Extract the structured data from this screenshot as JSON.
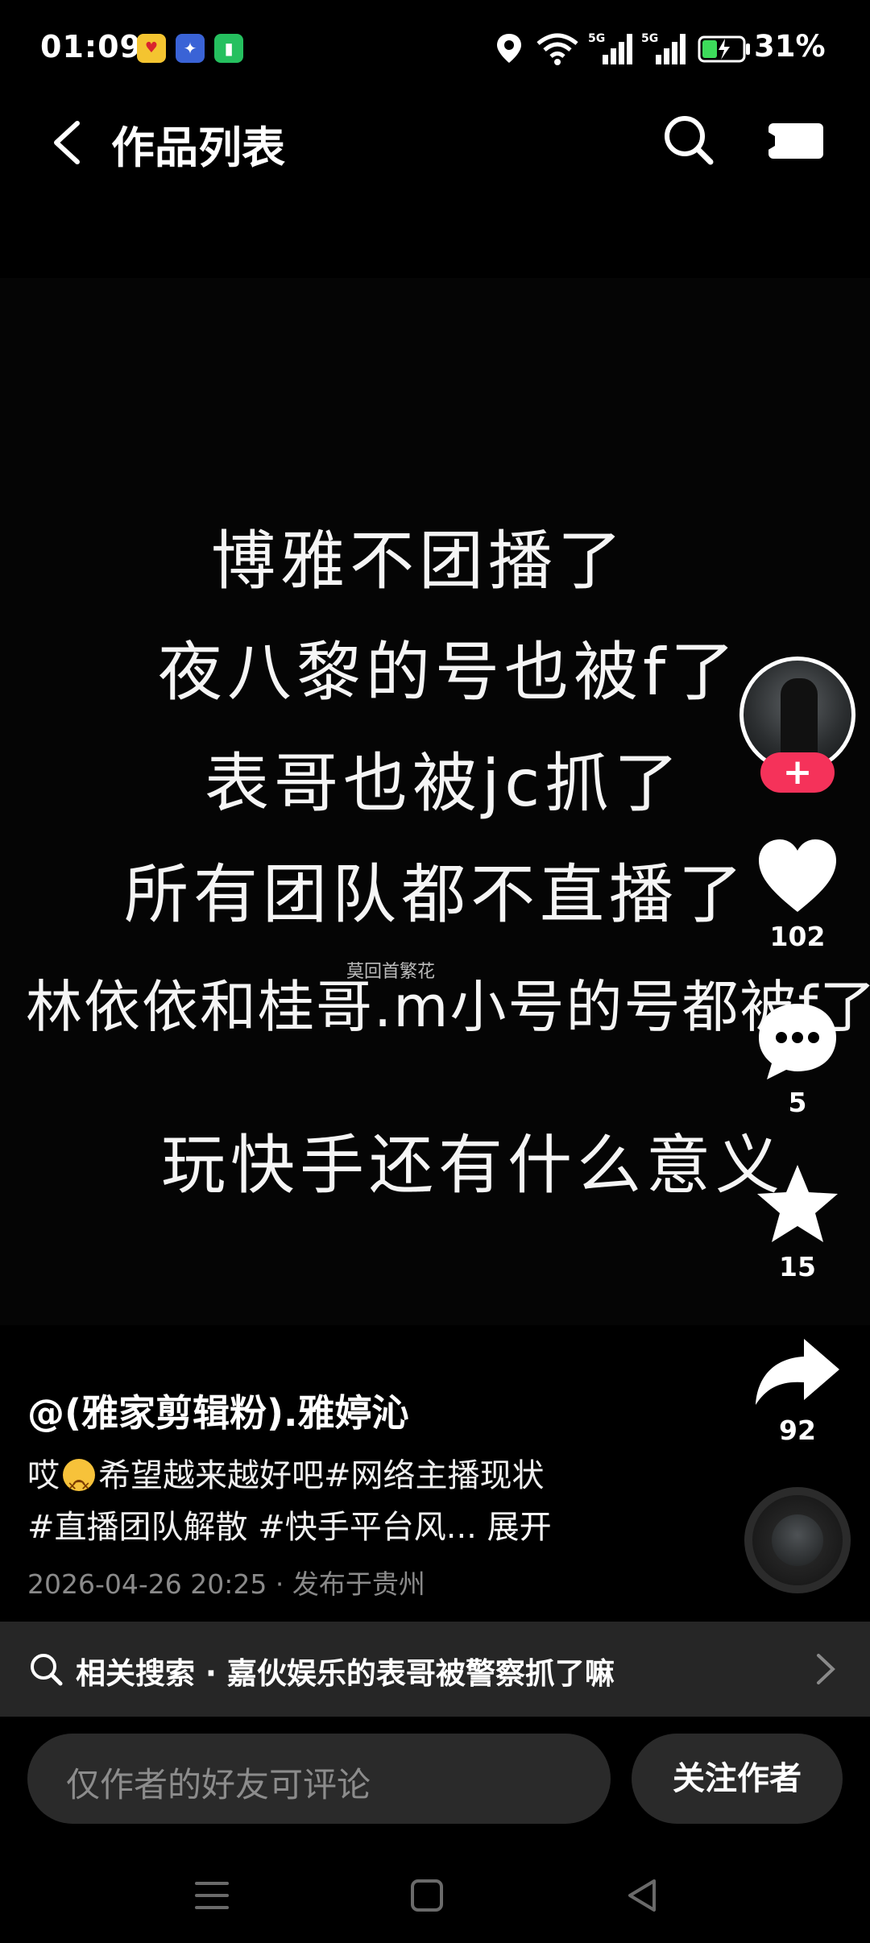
{
  "status_bar": {
    "time": "01:09",
    "battery": "31%",
    "app_icons": [
      "game-app-icon",
      "app-store-icon",
      "battery-saver-app-icon"
    ],
    "icons": [
      "location-icon",
      "wifi-icon",
      "signal-5g-icon",
      "signal-5g-icon",
      "battery-icon"
    ]
  },
  "header": {
    "title": "作品列表",
    "back_icon": "chevron-left-icon",
    "search_icon": "search-icon",
    "camera_icon": "camera-icon"
  },
  "video": {
    "lines": [
      "博雅不团播了",
      "夜八黎的号也被f了",
      "表哥也被jc抓了",
      "所有团队都不直播了",
      "林依依和桂哥.m小号的号都被f了",
      "玩快手还有什么意义"
    ],
    "watermark": "莫回首繁花"
  },
  "actions": {
    "likes": "102",
    "comments": "5",
    "favorites": "15",
    "shares": "92",
    "follow_plus": "+"
  },
  "post": {
    "author": "@(雅家剪辑粉).雅婷沁",
    "desc_part1": "哎",
    "desc_part2": "希望越来越好吧#网络主播现状",
    "desc_line2": "#直播团队解散 #快手平台风...",
    "expand": "展开",
    "meta": "2026-04-26 20:25 · 发布于贵州"
  },
  "related_search": {
    "label": "相关搜索 · 嘉伙娱乐的表哥被警察抓了嘛"
  },
  "comment_input": {
    "placeholder": "仅作者的好友可评论"
  },
  "follow_author": {
    "label": "关注作者"
  },
  "accent": "#f5325a"
}
